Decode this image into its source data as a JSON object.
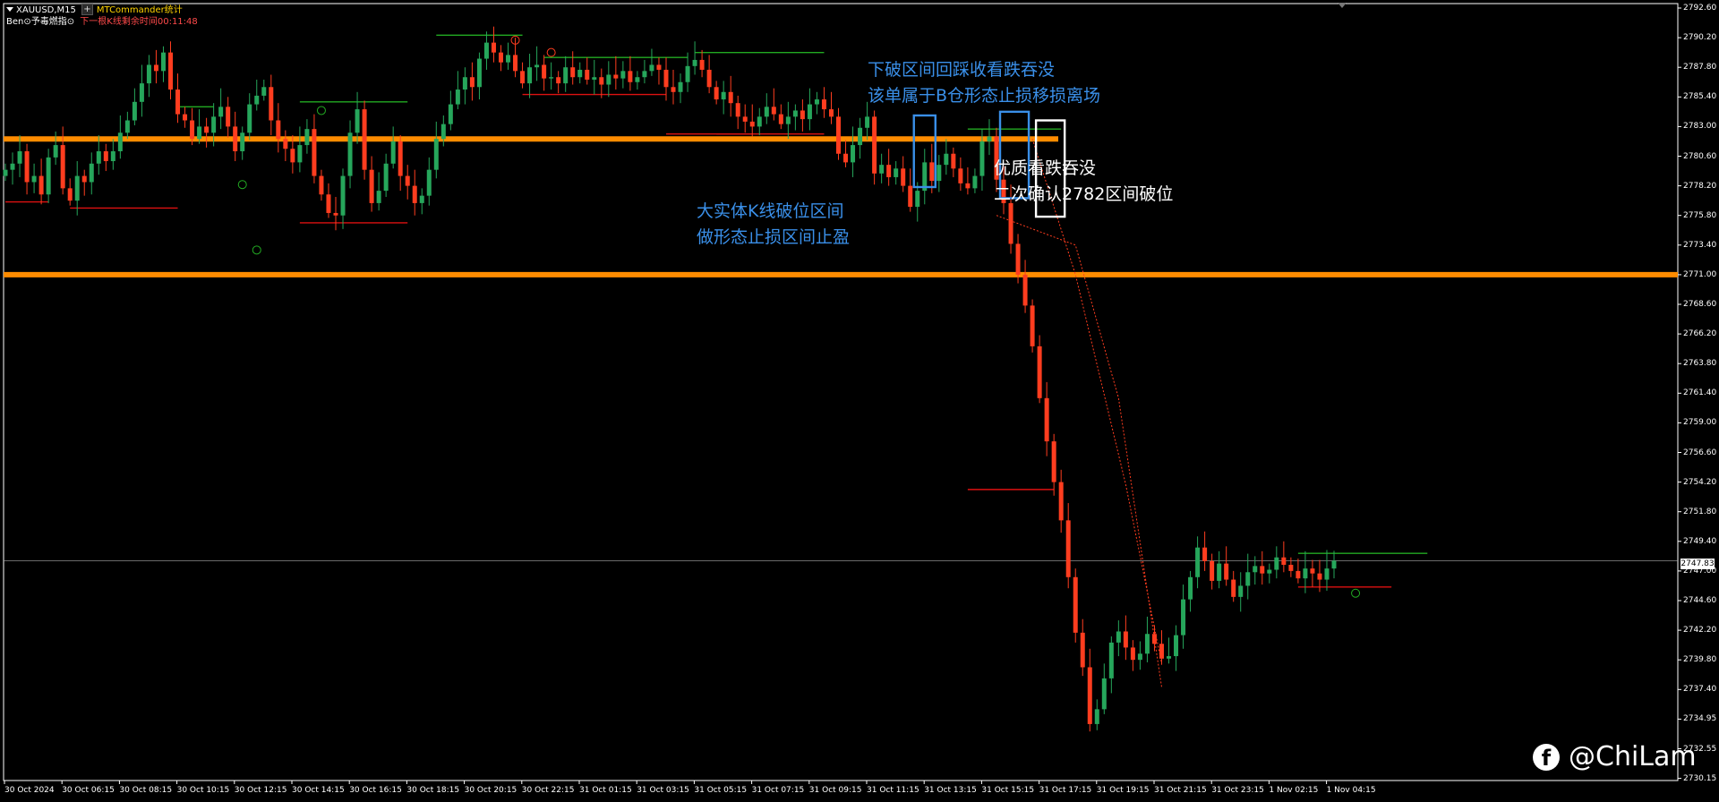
{
  "window": {
    "symbol": "XAUUSD,M15",
    "indicator_label": "MTCommander统计",
    "subtitle_label": "Ben⊙予毒燃指⊙",
    "countdown": "下一根K线剩余时间00:11:48"
  },
  "colors": {
    "background": "#000000",
    "bull": "#26a65b",
    "bear": "#ff3d1f",
    "zone": "#ff8c00",
    "blue_note": "#3a8fe8",
    "green_line": "#22aa22",
    "red_line": "#dd1111",
    "axis": "#ffffff"
  },
  "annotations": {
    "blue_top": [
      "下破区间回踩收看跌吞没",
      "该单属于B仓形态止损移损离场"
    ],
    "blue_mid": [
      "大实体K线破位区间",
      "做形态止损区间止盈"
    ],
    "white": [
      "优质看跌吞没",
      "二次确认2782区间破位"
    ]
  },
  "watermark": {
    "icon": "facebook-icon",
    "handle": "@ChiLam"
  },
  "current_price": "2747.83",
  "chart_data": {
    "type": "candlestick",
    "symbol": "XAUUSD",
    "timeframe": "M15",
    "y_ticks": [
      "2792.60",
      "2790.20",
      "2787.80",
      "2785.40",
      "2783.00",
      "2780.60",
      "2778.20",
      "2775.80",
      "2773.40",
      "2771.00",
      "2768.60",
      "2766.20",
      "2763.80",
      "2761.40",
      "2759.00",
      "2756.60",
      "2754.20",
      "2751.80",
      "2749.40",
      "2747.00",
      "2744.60",
      "2742.20",
      "2739.80",
      "2737.40",
      "2734.95",
      "2732.55",
      "2730.15"
    ],
    "x_ticks": [
      "30 Oct 2024",
      "30 Oct 06:15",
      "30 Oct 08:15",
      "30 Oct 10:15",
      "30 Oct 12:15",
      "30 Oct 14:15",
      "30 Oct 16:15",
      "30 Oct 18:15",
      "30 Oct 20:15",
      "30 Oct 22:15",
      "31 Oct 01:15",
      "31 Oct 03:15",
      "31 Oct 05:15",
      "31 Oct 07:15",
      "31 Oct 09:15",
      "31 Oct 11:15",
      "31 Oct 13:15",
      "31 Oct 15:15",
      "31 Oct 17:15",
      "31 Oct 19:15",
      "31 Oct 21:15",
      "31 Oct 23:15",
      "1 Nov 02:15",
      "1 Nov 04:15"
    ],
    "ylim": [
      2730.15,
      2793.0
    ],
    "zones": [
      2782.0,
      2771.0
    ],
    "close_path": [
      2779.5,
      2780,
      2781,
      2778.5,
      2779,
      2777.5,
      2780.5,
      2781.5,
      2778,
      2777,
      2779,
      2778.5,
      2780,
      2781,
      2780.2,
      2781,
      2782.5,
      2783.5,
      2785,
      2786.5,
      2788,
      2787.5,
      2789,
      2786,
      2784,
      2783.5,
      2782,
      2783,
      2782.5,
      2783.8,
      2784.6,
      2783,
      2781,
      2782.5,
      2784.8,
      2785.5,
      2786.2,
      2783.5,
      2782,
      2781.2,
      2780.1,
      2781.5,
      2782.8,
      2779,
      2777.5,
      2776,
      2775.8,
      2779,
      2782.5,
      2784.4,
      2779.5,
      2776.8,
      2777.8,
      2780,
      2781.8,
      2779,
      2778.2,
      2776.8,
      2777.4,
      2779.5,
      2782,
      2783.2,
      2784.8,
      2786,
      2787,
      2786.2,
      2788.5,
      2789.8,
      2789,
      2788.2,
      2788.8,
      2787.5,
      2786.5,
      2787.8,
      2788,
      2786.9,
      2787,
      2786.5,
      2787.8,
      2787,
      2787.6,
      2786.8,
      2787,
      2786.4,
      2787.2,
      2786.9,
      2787.5,
      2786.6,
      2787,
      2787.5,
      2788,
      2787.6,
      2786.2,
      2785.8,
      2786.6,
      2787.9,
      2788.4,
      2787.6,
      2786.2,
      2785.2,
      2785.8,
      2784.9,
      2783.8,
      2783.4,
      2783,
      2783.8,
      2784.6,
      2784,
      2783.2,
      2783.8,
      2784.3,
      2783.6,
      2784.8,
      2785.2,
      2784.4,
      2783.8,
      2780.8,
      2780.1,
      2781.5,
      2782.9,
      2783.8,
      2779.2,
      2779.9,
      2778.9,
      2779.6,
      2778.2,
      2776.5,
      2777.8,
      2780.1,
      2778.6,
      2779.9,
      2780.8,
      2779.6,
      2778.4,
      2778,
      2779,
      2781.8,
      2782.2,
      2778.7,
      2776.8,
      2773.5,
      2771,
      2768.5,
      2765.2,
      2761,
      2757.5,
      2754.2,
      2751.1,
      2746.5,
      2742,
      2739.2,
      2734.6,
      2735.8,
      2738.3,
      2741.2,
      2742.1,
      2740.8,
      2739.8,
      2740.3,
      2741.9,
      2741.1,
      2739.9,
      2740.1,
      2741.8,
      2744.7,
      2746.5,
      2748.9,
      2747.8,
      2746.2,
      2747.6,
      2746.3,
      2744.9,
      2745.8,
      2746.9,
      2747.4,
      2746.8,
      2747.1,
      2748.1,
      2747.5,
      2747.0,
      2746.4,
      2747.2,
      2746.8,
      2746.3,
      2747.2,
      2747.83
    ],
    "boxes": [
      {
        "color": "blue",
        "t0": 127,
        "t1": 129,
        "hi": 2783.9,
        "lo": 2778.1
      },
      {
        "color": "blue",
        "t0": 139,
        "t1": 142,
        "hi": 2784.2,
        "lo": 2777.2
      },
      {
        "color": "white",
        "t0": 144,
        "t1": 147,
        "hi": 2783.5,
        "lo": 2775.7
      }
    ]
  }
}
